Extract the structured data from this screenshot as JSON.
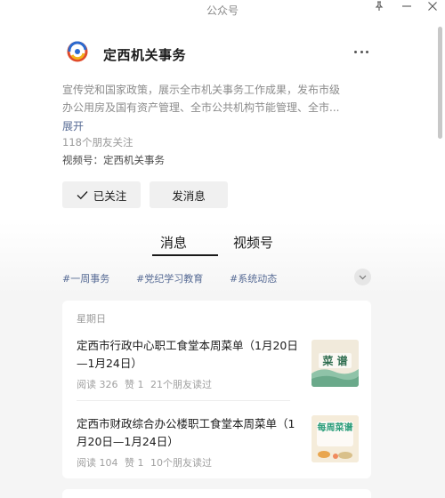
{
  "window": {
    "title": "公众号"
  },
  "account": {
    "name": "定西机关事务",
    "logo_caption": "定西机关事务",
    "description_line1": "宣传党和国家政策，展示全市机关事务工作成果，发布市级",
    "description_line2": "办公用房及国有资产管理、全市公共机构节能管理、全市...",
    "expand_label": "展开",
    "followers": "118个朋友关注",
    "channel": "视频号：定西机关事务"
  },
  "actions": {
    "followed_label": "已关注",
    "message_label": "发消息"
  },
  "tabs": [
    {
      "label": "消息",
      "active": true
    },
    {
      "label": "视频号",
      "active": false
    }
  ],
  "tags": [
    "#一周事务",
    "#党纪学习教育",
    "#系统动态"
  ],
  "feed": {
    "day": "星期日",
    "articles": [
      {
        "title": "定西市行政中心职工食堂本周菜单（1月20日—1月24日）",
        "reads": "阅读 326",
        "likes": "赞 1",
        "friends": "21个朋友读过",
        "thumb_text": "菜 谱"
      },
      {
        "title": "定西市财政综合办公楼职工食堂本周菜单（1月20日—1月24日）",
        "reads": "阅读 104",
        "likes": "赞 1",
        "friends": "10个朋友读过",
        "thumb_text": "每周菜谱"
      }
    ]
  },
  "colors": {
    "link": "#576b95",
    "button_bg": "#f0f0f0",
    "page_bg": "#f5f5f5"
  }
}
